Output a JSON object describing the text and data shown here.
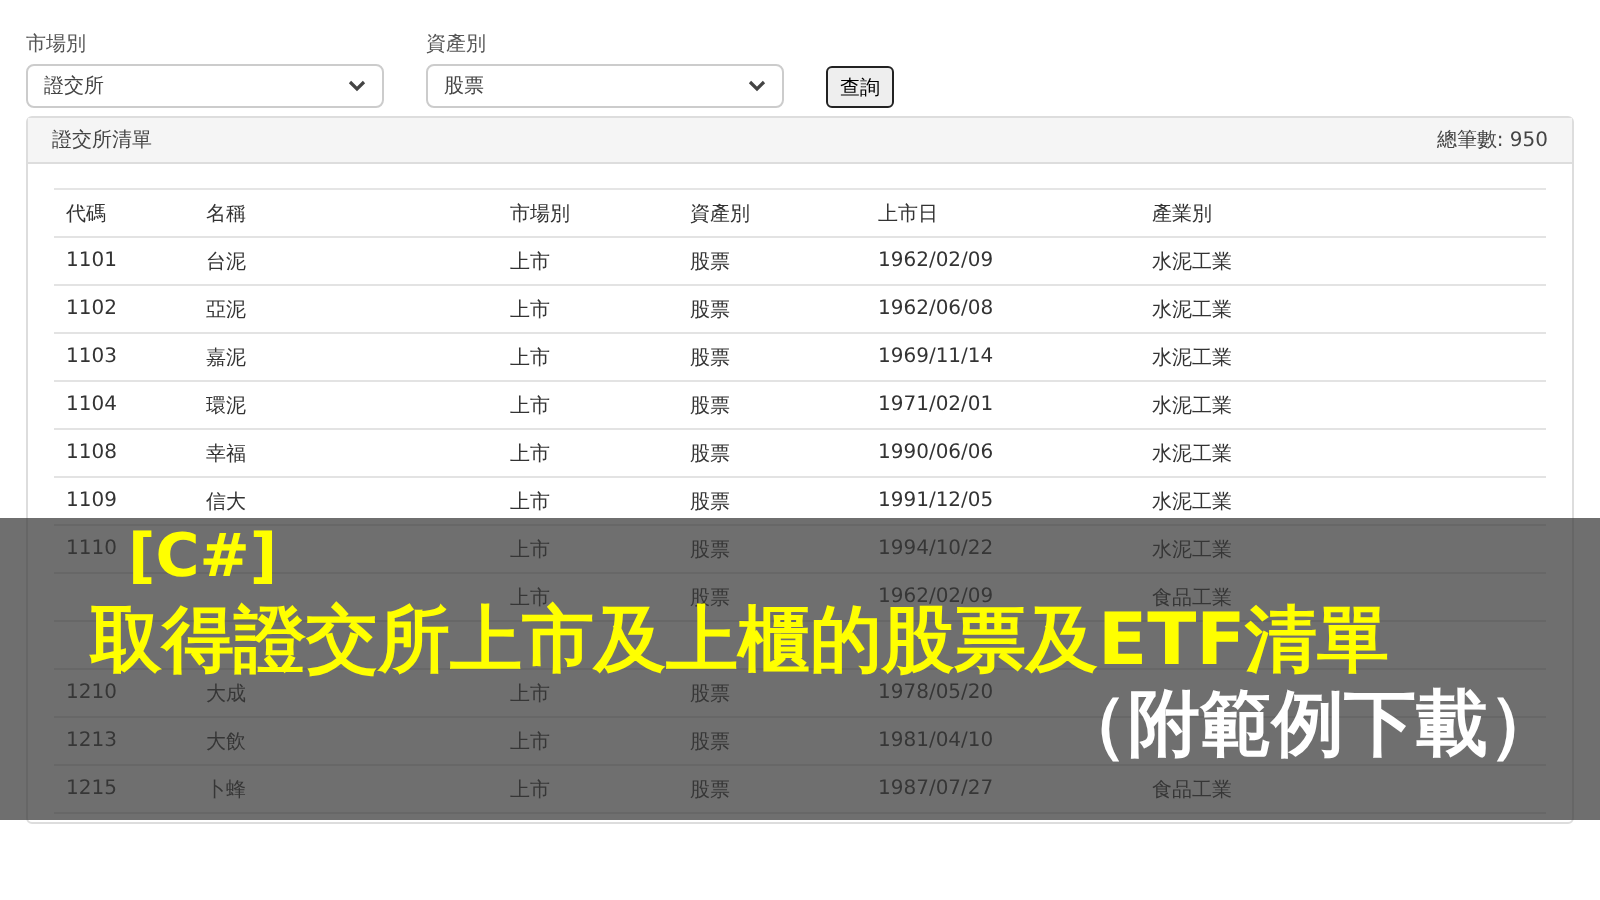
{
  "filters": [
    {
      "label": "市場別",
      "value": "證交所"
    },
    {
      "label": "資產別",
      "value": "股票"
    }
  ],
  "query_button": "查詢",
  "panel": {
    "title": "證交所清單",
    "total": "總筆數: 950"
  },
  "table": {
    "columns": [
      "代碼",
      "名稱",
      "市場別",
      "資產別",
      "上市日",
      "產業別"
    ],
    "rows": [
      {
        "cells": [
          "1101",
          "台泥",
          "上市",
          "股票",
          "1962/02/09",
          "水泥工業"
        ]
      },
      {
        "cells": [
          "1102",
          "亞泥",
          "上市",
          "股票",
          "1962/06/08",
          "水泥工業"
        ]
      },
      {
        "cells": [
          "1103",
          "嘉泥",
          "上市",
          "股票",
          "1969/11/14",
          "水泥工業"
        ]
      },
      {
        "cells": [
          "1104",
          "環泥",
          "上市",
          "股票",
          "1971/02/01",
          "水泥工業"
        ]
      },
      {
        "cells": [
          "1108",
          "幸福",
          "上市",
          "股票",
          "1990/06/06",
          "水泥工業"
        ]
      },
      {
        "cells": [
          "1109",
          "信大",
          "上市",
          "股票",
          "1991/12/05",
          "水泥工業"
        ]
      },
      {
        "cells": [
          "1110",
          null,
          "上市",
          "股票",
          "1994/10/22",
          "水泥工業"
        ]
      },
      {
        "cells": [
          null,
          null,
          "上市",
          "股票",
          "1962/02/09",
          "食品工業"
        ]
      },
      {
        "cells": [
          null,
          null,
          null,
          null,
          null,
          null
        ]
      },
      {
        "cells": [
          "1210",
          "大成",
          "上市",
          "股票",
          "1978/05/20",
          null
        ]
      },
      {
        "cells": [
          "1213",
          "大飲",
          "上市",
          "股票",
          "1981/04/10",
          null
        ]
      },
      {
        "cells": [
          "1215",
          "卜蜂",
          "上市",
          "股票",
          "1987/07/27",
          "食品工業"
        ]
      }
    ]
  },
  "banner": {
    "tag": "[C#]",
    "title": "取得證交所上市及上櫃的股票及ETF清單",
    "subtitle": "（附範例下載）"
  }
}
